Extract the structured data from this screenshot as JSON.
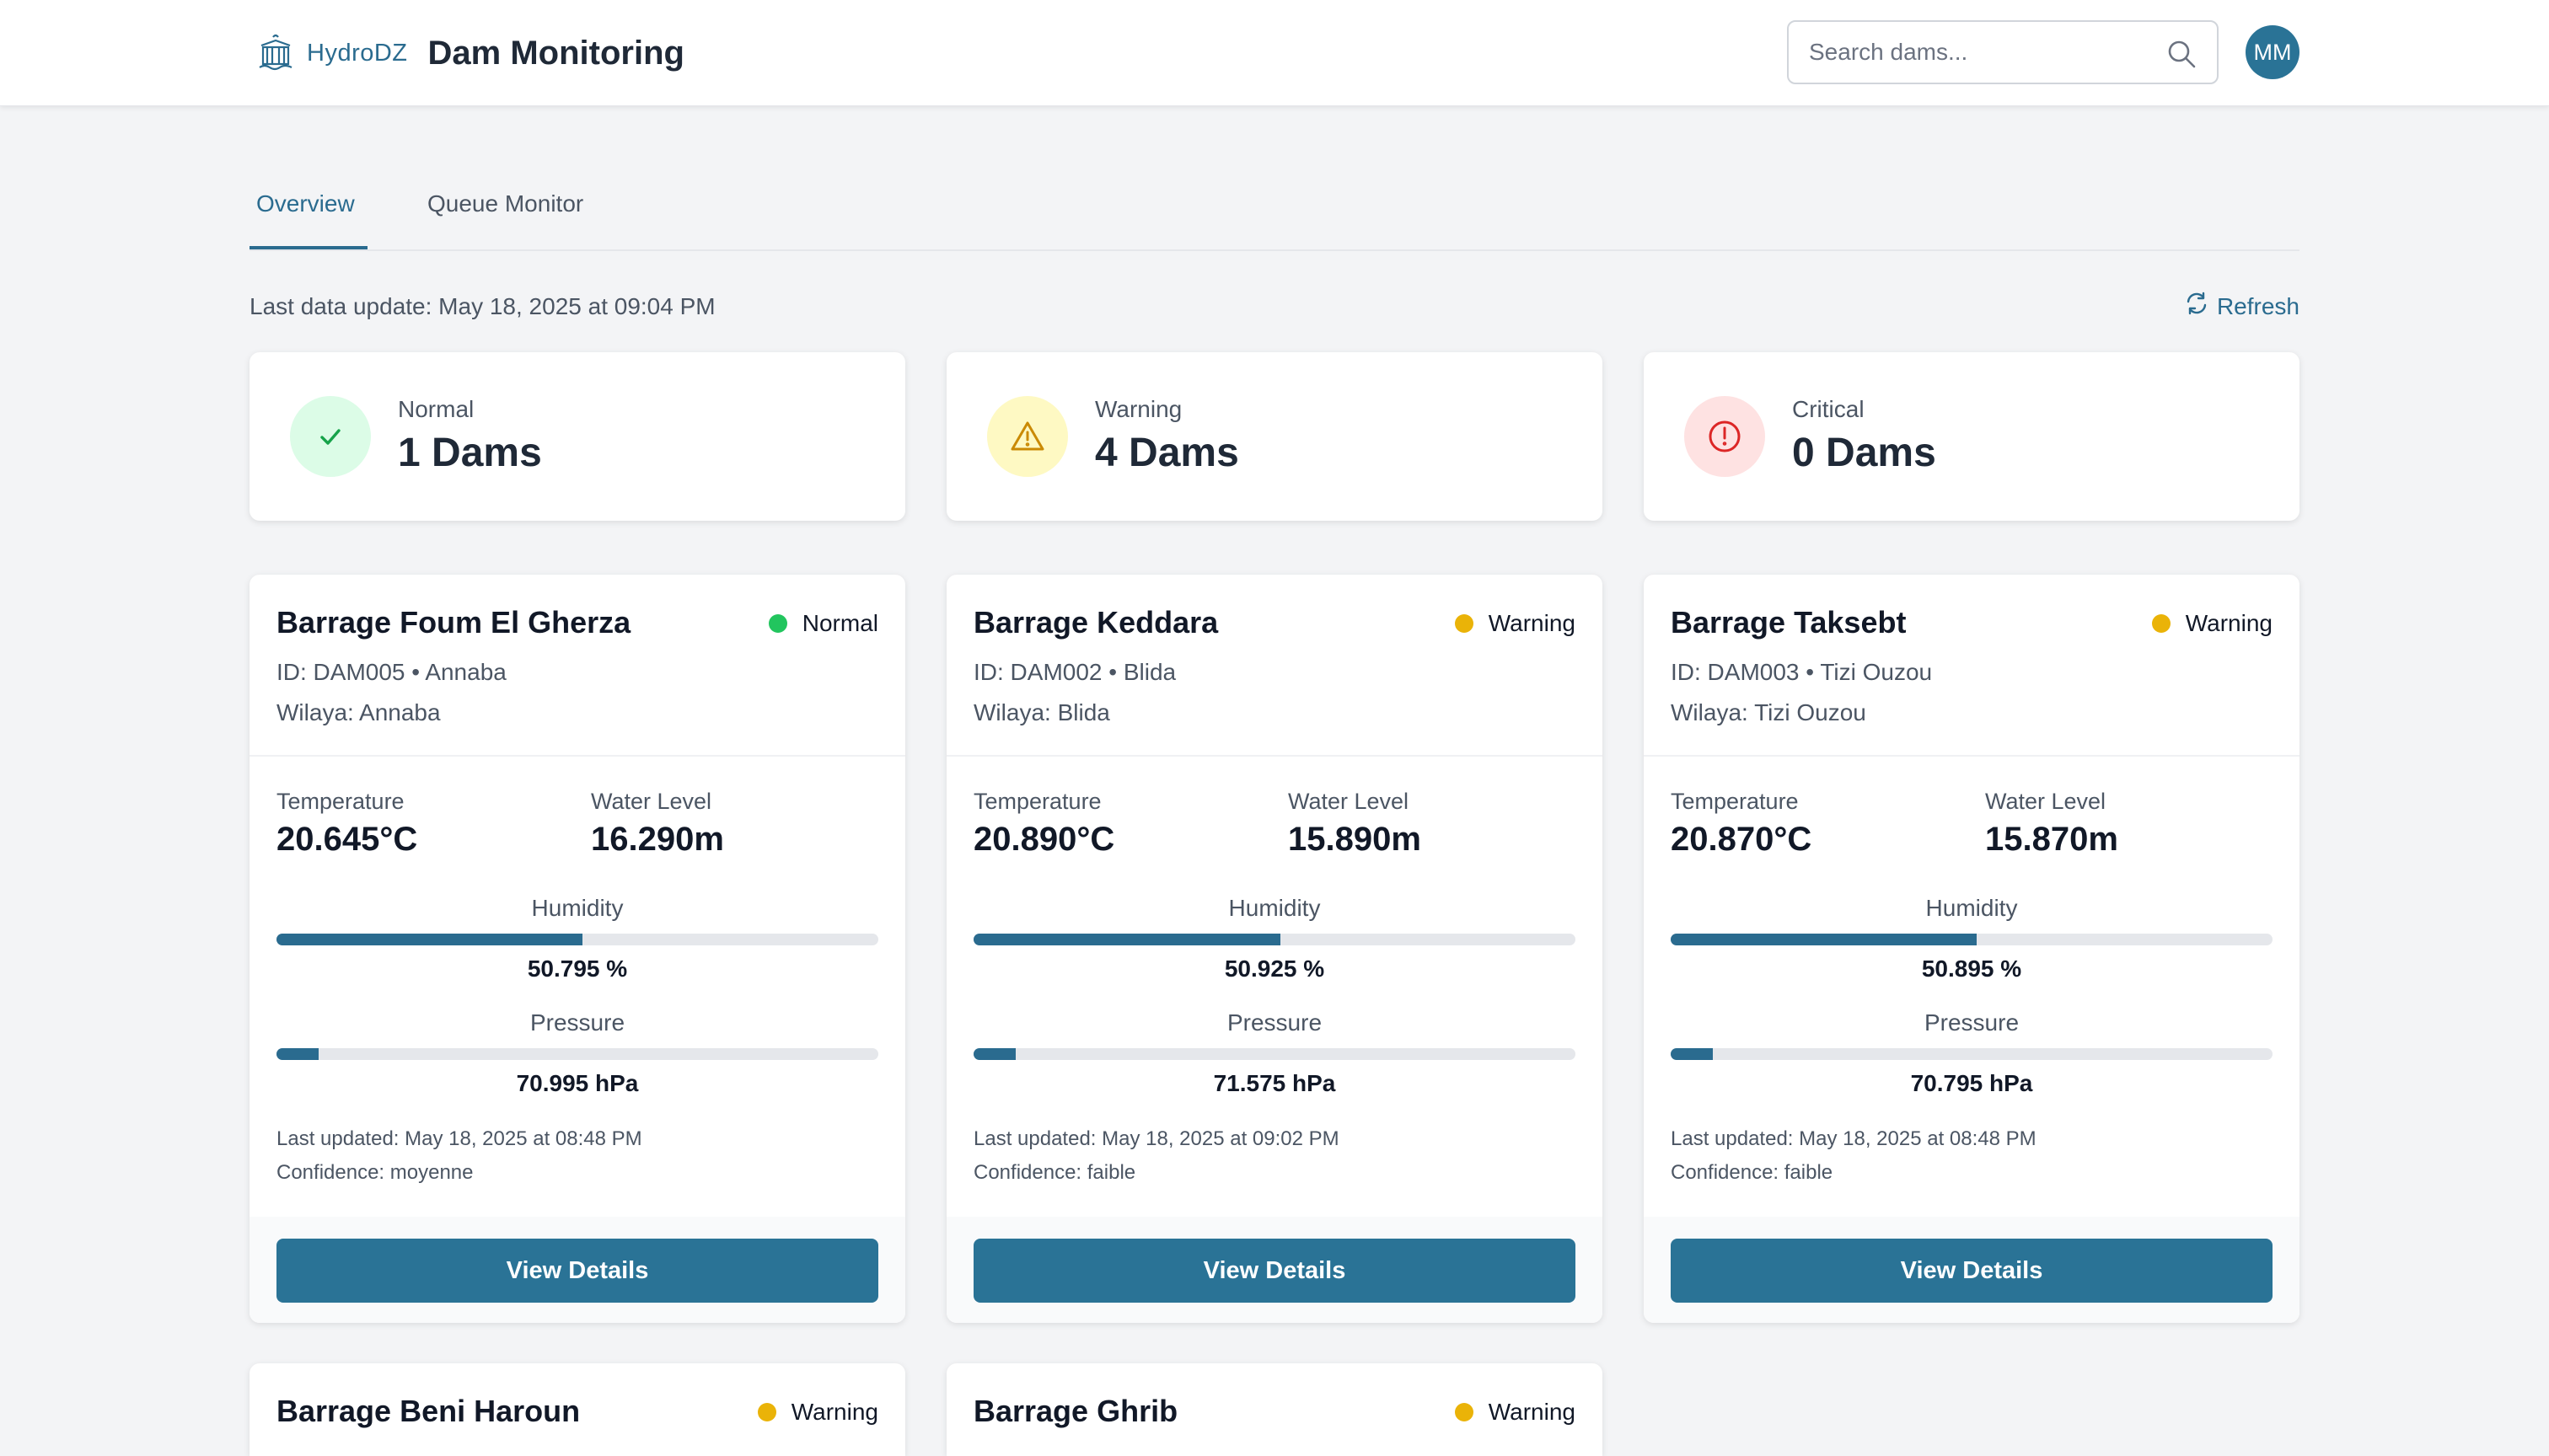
{
  "header": {
    "brand_name": "HydroDZ",
    "app_title": "Dam Monitoring",
    "search_placeholder": "Search dams...",
    "avatar_initials": "MM"
  },
  "tabs": [
    {
      "label": "Overview",
      "active": true
    },
    {
      "label": "Queue Monitor",
      "active": false
    }
  ],
  "last_update": "Last data update: May 18, 2025 at 09:04 PM",
  "refresh_label": "Refresh",
  "summary": [
    {
      "label": "Normal",
      "value": "1 Dams",
      "icon": "check-icon",
      "color": "#16a34a",
      "bg": "#dcfce7"
    },
    {
      "label": "Warning",
      "value": "4 Dams",
      "icon": "warning-triangle-icon",
      "color": "#ca8a04",
      "bg": "#fef9c3"
    },
    {
      "label": "Critical",
      "value": "0 Dams",
      "icon": "alert-circle-icon",
      "color": "#dc2626",
      "bg": "#fee2e2"
    }
  ],
  "labels": {
    "temperature": "Temperature",
    "water_level": "Water Level",
    "humidity": "Humidity",
    "pressure": "Pressure",
    "view_details": "View Details"
  },
  "status_colors": {
    "Normal": "#22c55e",
    "Warning": "#eab308"
  },
  "dams": [
    {
      "name": "Barrage Foum El Gherza",
      "status": "Normal",
      "id_line": "ID: DAM005 • Annaba",
      "wilaya": "Wilaya: Annaba",
      "temperature": "20.645°C",
      "water_level": "16.290m",
      "humidity": "50.795 %",
      "humidity_pct": 50.795,
      "pressure": "70.995 hPa",
      "pressure_fill": 0.07,
      "last_updated": "Last updated: May 18, 2025 at 08:48 PM",
      "confidence": "Confidence: moyenne"
    },
    {
      "name": "Barrage Keddara",
      "status": "Warning",
      "id_line": "ID: DAM002 • Blida",
      "wilaya": "Wilaya: Blida",
      "temperature": "20.890°C",
      "water_level": "15.890m",
      "humidity": "50.925 %",
      "humidity_pct": 50.925,
      "pressure": "71.575 hPa",
      "pressure_fill": 0.07,
      "last_updated": "Last updated: May 18, 2025 at 09:02 PM",
      "confidence": "Confidence: faible"
    },
    {
      "name": "Barrage Taksebt",
      "status": "Warning",
      "id_line": "ID: DAM003 • Tizi Ouzou",
      "wilaya": "Wilaya: Tizi Ouzou",
      "temperature": "20.870°C",
      "water_level": "15.870m",
      "humidity": "50.895 %",
      "humidity_pct": 50.895,
      "pressure": "70.795 hPa",
      "pressure_fill": 0.07,
      "last_updated": "Last updated: May 18, 2025 at 08:48 PM",
      "confidence": "Confidence: faible"
    },
    {
      "name": "Barrage Beni Haroun",
      "status": "Warning"
    },
    {
      "name": "Barrage Ghrib",
      "status": "Warning"
    }
  ]
}
